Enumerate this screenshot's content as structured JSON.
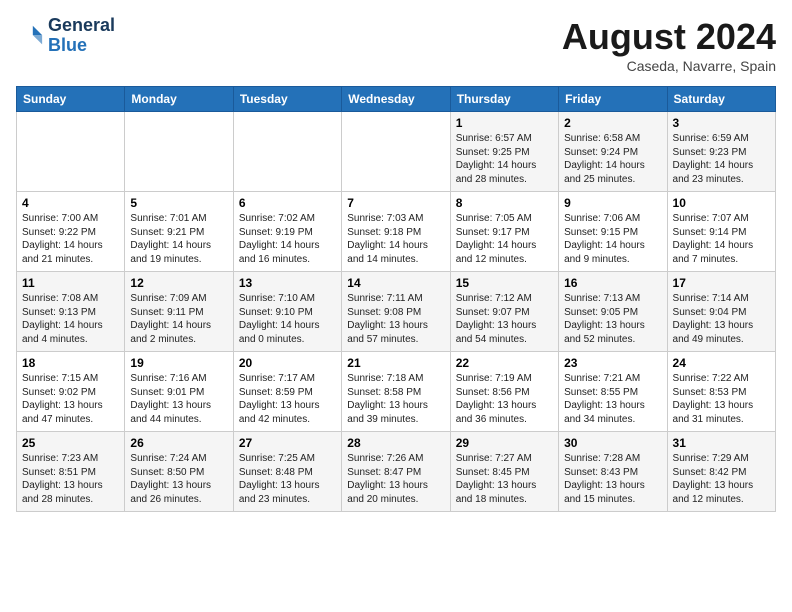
{
  "logo": {
    "line1": "General",
    "line2": "Blue"
  },
  "title": "August 2024",
  "subtitle": "Caseda, Navarre, Spain",
  "days_of_week": [
    "Sunday",
    "Monday",
    "Tuesday",
    "Wednesday",
    "Thursday",
    "Friday",
    "Saturday"
  ],
  "weeks": [
    [
      {
        "day": "",
        "info": ""
      },
      {
        "day": "",
        "info": ""
      },
      {
        "day": "",
        "info": ""
      },
      {
        "day": "",
        "info": ""
      },
      {
        "day": "1",
        "info": "Sunrise: 6:57 AM\nSunset: 9:25 PM\nDaylight: 14 hours\nand 28 minutes."
      },
      {
        "day": "2",
        "info": "Sunrise: 6:58 AM\nSunset: 9:24 PM\nDaylight: 14 hours\nand 25 minutes."
      },
      {
        "day": "3",
        "info": "Sunrise: 6:59 AM\nSunset: 9:23 PM\nDaylight: 14 hours\nand 23 minutes."
      }
    ],
    [
      {
        "day": "4",
        "info": "Sunrise: 7:00 AM\nSunset: 9:22 PM\nDaylight: 14 hours\nand 21 minutes."
      },
      {
        "day": "5",
        "info": "Sunrise: 7:01 AM\nSunset: 9:21 PM\nDaylight: 14 hours\nand 19 minutes."
      },
      {
        "day": "6",
        "info": "Sunrise: 7:02 AM\nSunset: 9:19 PM\nDaylight: 14 hours\nand 16 minutes."
      },
      {
        "day": "7",
        "info": "Sunrise: 7:03 AM\nSunset: 9:18 PM\nDaylight: 14 hours\nand 14 minutes."
      },
      {
        "day": "8",
        "info": "Sunrise: 7:05 AM\nSunset: 9:17 PM\nDaylight: 14 hours\nand 12 minutes."
      },
      {
        "day": "9",
        "info": "Sunrise: 7:06 AM\nSunset: 9:15 PM\nDaylight: 14 hours\nand 9 minutes."
      },
      {
        "day": "10",
        "info": "Sunrise: 7:07 AM\nSunset: 9:14 PM\nDaylight: 14 hours\nand 7 minutes."
      }
    ],
    [
      {
        "day": "11",
        "info": "Sunrise: 7:08 AM\nSunset: 9:13 PM\nDaylight: 14 hours\nand 4 minutes."
      },
      {
        "day": "12",
        "info": "Sunrise: 7:09 AM\nSunset: 9:11 PM\nDaylight: 14 hours\nand 2 minutes."
      },
      {
        "day": "13",
        "info": "Sunrise: 7:10 AM\nSunset: 9:10 PM\nDaylight: 14 hours\nand 0 minutes."
      },
      {
        "day": "14",
        "info": "Sunrise: 7:11 AM\nSunset: 9:08 PM\nDaylight: 13 hours\nand 57 minutes."
      },
      {
        "day": "15",
        "info": "Sunrise: 7:12 AM\nSunset: 9:07 PM\nDaylight: 13 hours\nand 54 minutes."
      },
      {
        "day": "16",
        "info": "Sunrise: 7:13 AM\nSunset: 9:05 PM\nDaylight: 13 hours\nand 52 minutes."
      },
      {
        "day": "17",
        "info": "Sunrise: 7:14 AM\nSunset: 9:04 PM\nDaylight: 13 hours\nand 49 minutes."
      }
    ],
    [
      {
        "day": "18",
        "info": "Sunrise: 7:15 AM\nSunset: 9:02 PM\nDaylight: 13 hours\nand 47 minutes."
      },
      {
        "day": "19",
        "info": "Sunrise: 7:16 AM\nSunset: 9:01 PM\nDaylight: 13 hours\nand 44 minutes."
      },
      {
        "day": "20",
        "info": "Sunrise: 7:17 AM\nSunset: 8:59 PM\nDaylight: 13 hours\nand 42 minutes."
      },
      {
        "day": "21",
        "info": "Sunrise: 7:18 AM\nSunset: 8:58 PM\nDaylight: 13 hours\nand 39 minutes."
      },
      {
        "day": "22",
        "info": "Sunrise: 7:19 AM\nSunset: 8:56 PM\nDaylight: 13 hours\nand 36 minutes."
      },
      {
        "day": "23",
        "info": "Sunrise: 7:21 AM\nSunset: 8:55 PM\nDaylight: 13 hours\nand 34 minutes."
      },
      {
        "day": "24",
        "info": "Sunrise: 7:22 AM\nSunset: 8:53 PM\nDaylight: 13 hours\nand 31 minutes."
      }
    ],
    [
      {
        "day": "25",
        "info": "Sunrise: 7:23 AM\nSunset: 8:51 PM\nDaylight: 13 hours\nand 28 minutes."
      },
      {
        "day": "26",
        "info": "Sunrise: 7:24 AM\nSunset: 8:50 PM\nDaylight: 13 hours\nand 26 minutes."
      },
      {
        "day": "27",
        "info": "Sunrise: 7:25 AM\nSunset: 8:48 PM\nDaylight: 13 hours\nand 23 minutes."
      },
      {
        "day": "28",
        "info": "Sunrise: 7:26 AM\nSunset: 8:47 PM\nDaylight: 13 hours\nand 20 minutes."
      },
      {
        "day": "29",
        "info": "Sunrise: 7:27 AM\nSunset: 8:45 PM\nDaylight: 13 hours\nand 18 minutes."
      },
      {
        "day": "30",
        "info": "Sunrise: 7:28 AM\nSunset: 8:43 PM\nDaylight: 13 hours\nand 15 minutes."
      },
      {
        "day": "31",
        "info": "Sunrise: 7:29 AM\nSunset: 8:42 PM\nDaylight: 13 hours\nand 12 minutes."
      }
    ]
  ]
}
